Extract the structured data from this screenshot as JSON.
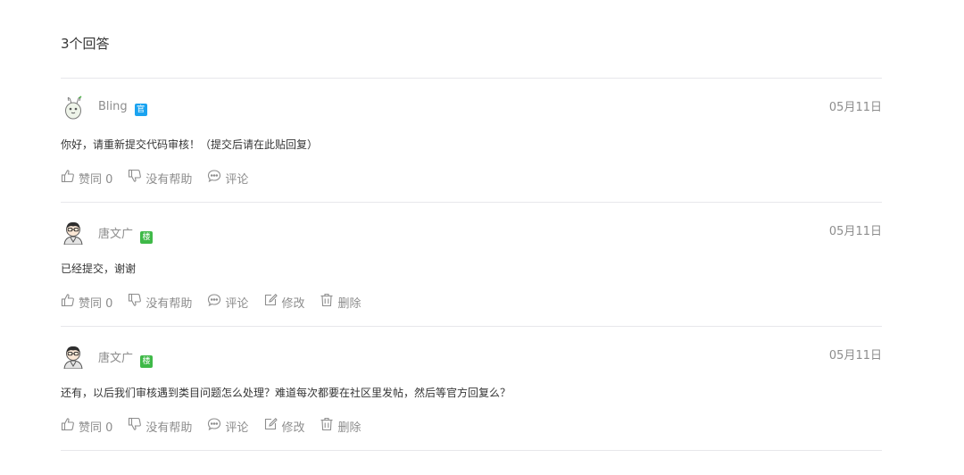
{
  "header": {
    "count_text": "3个回答"
  },
  "answers": [
    {
      "author": "Bling",
      "badge": {
        "text": "官",
        "color": "#1aa3f0"
      },
      "avatar": "rabbit-avatar",
      "date": "05月11日",
      "content": "你好，请重新提交代码审核！（提交后请在此贴回复）",
      "actions": [
        {
          "icon": "thumbs-up-icon",
          "label": "赞同 0"
        },
        {
          "icon": "thumbs-down-icon",
          "label": "没有帮助"
        },
        {
          "icon": "comment-icon",
          "label": "评论"
        }
      ]
    },
    {
      "author": "唐文广",
      "badge": {
        "text": "楼",
        "color": "#3fb948"
      },
      "avatar": "person-avatar",
      "date": "05月11日",
      "content": "已经提交，谢谢",
      "actions": [
        {
          "icon": "thumbs-up-icon",
          "label": "赞同 0"
        },
        {
          "icon": "thumbs-down-icon",
          "label": "没有帮助"
        },
        {
          "icon": "comment-icon",
          "label": "评论"
        },
        {
          "icon": "edit-icon",
          "label": "修改"
        },
        {
          "icon": "trash-icon",
          "label": "删除"
        }
      ]
    },
    {
      "author": "唐文广",
      "badge": {
        "text": "楼",
        "color": "#3fb948"
      },
      "avatar": "person-avatar",
      "date": "05月11日",
      "content": "还有，以后我们审核遇到类目问题怎么处理？难道每次都要在社区里发帖，然后等官方回复么？",
      "actions": [
        {
          "icon": "thumbs-up-icon",
          "label": "赞同 0"
        },
        {
          "icon": "thumbs-down-icon",
          "label": "没有帮助"
        },
        {
          "icon": "comment-icon",
          "label": "评论"
        },
        {
          "icon": "edit-icon",
          "label": "修改"
        },
        {
          "icon": "trash-icon",
          "label": "删除"
        }
      ]
    }
  ]
}
